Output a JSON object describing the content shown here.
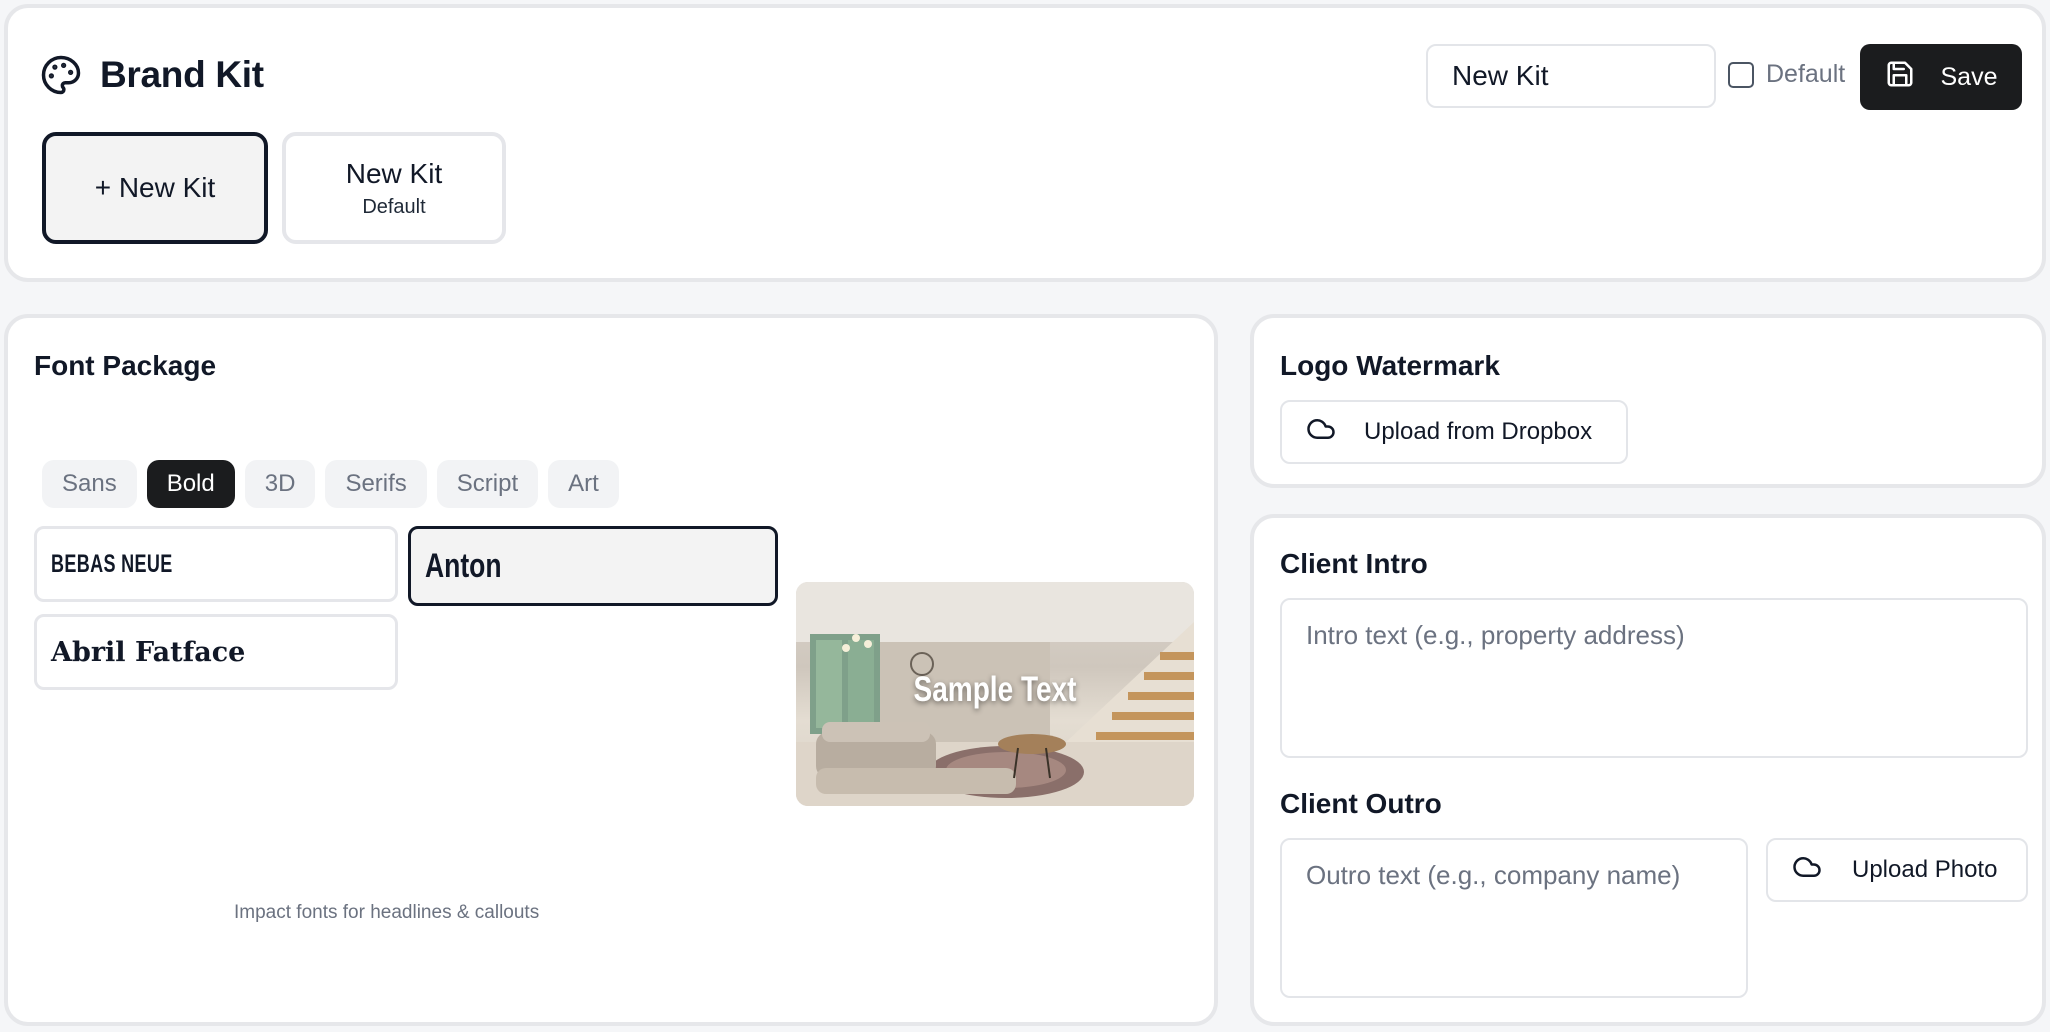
{
  "header": {
    "title": "Brand Kit",
    "title_icon": "palette-icon",
    "kit_name_value": "New Kit",
    "default_label": "Default",
    "default_checked": false,
    "save_label": "Save",
    "save_icon": "floppy-disk-icon"
  },
  "kits": {
    "new_kit_label": "+ New Kit",
    "items": [
      {
        "name": "New Kit",
        "subtitle": "Default"
      }
    ]
  },
  "font_package": {
    "title": "Font Package",
    "tabs": [
      "Sans",
      "Bold",
      "3D",
      "Serifs",
      "Script",
      "Art"
    ],
    "active_tab": "Bold",
    "fonts": [
      "BEBAS NEUE",
      "Anton",
      "Abril Fatface"
    ],
    "selected_font": "Anton",
    "preview_text": "Sample Text",
    "description": "Impact fonts for headlines & callouts"
  },
  "logo_watermark": {
    "title": "Logo Watermark",
    "upload_label": "Upload from Dropbox",
    "upload_icon": "cloud-icon"
  },
  "client": {
    "intro_title": "Client Intro",
    "intro_placeholder": "Intro text (e.g., property address)",
    "outro_title": "Client Outro",
    "outro_placeholder": "Outro text (e.g., company name)",
    "upload_photo_label": "Upload Photo",
    "upload_photo_icon": "cloud-icon"
  },
  "colors": {
    "primary_dark": "#1b1c1e",
    "border": "#e6e7ea",
    "muted_text": "#6b7280",
    "background": "#f5f6f8"
  }
}
